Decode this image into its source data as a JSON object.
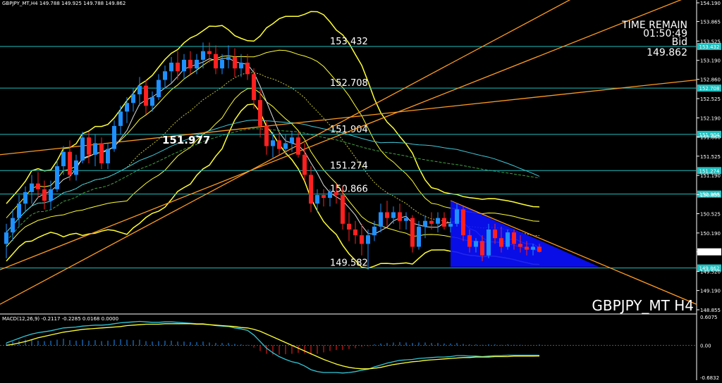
{
  "header": {
    "symbol_line": "GBPJPY_MT,H4  149.788 149.925 149.788 149.862"
  },
  "info_box": {
    "time_remain_label": "TIME REMAIN",
    "time_remain_value": "01:50:49",
    "bid_label": "Bid",
    "bid_value": "149.862"
  },
  "symbol_watermark": "GBPJPY_MT H4",
  "annotation": "151.977",
  "macd": {
    "label": "MACD(12,26,9) -0.2117 -0.2285 0.0168 0.0000",
    "axis_labels": [
      "0.6075",
      "0.00",
      "-0.6832"
    ]
  },
  "colors": {
    "background": "#000000",
    "bull": "#1e90ff",
    "bear": "#ff2020",
    "bollinger": "#ffff33",
    "horizontal_line": "#20c0c0",
    "trendline": "#ff9a20",
    "triangle": "#0a10ff",
    "ma_long": "#40c8d8",
    "macd_signal": "#ffff33",
    "macd_main": "#30c8d8"
  },
  "chart_data": [
    {
      "type": "candlestick",
      "title": "GBPJPY_MT H4",
      "ylim": [
        148.855,
        154.19
      ],
      "y_ticks": [
        154.19,
        153.865,
        153.525,
        153.19,
        152.86,
        152.525,
        152.19,
        151.86,
        151.525,
        151.19,
        150.855,
        150.525,
        150.19,
        149.862,
        149.52,
        149.19,
        148.855
      ],
      "horizontal_lines": [
        {
          "value": 153.432,
          "label": "153.432",
          "axis_label": "153.432"
        },
        {
          "value": 152.708,
          "label": "152.708",
          "axis_label": "152.708"
        },
        {
          "value": 151.904,
          "label": "151.904",
          "axis_label": "151.904"
        },
        {
          "value": 151.274,
          "label": "151.274",
          "axis_label": "151.274"
        },
        {
          "value": 150.866,
          "label": "150.866",
          "axis_label": "150.866"
        },
        {
          "value": 149.582,
          "label": "149.582",
          "axis_label": "149.862"
        }
      ],
      "current_price": 149.862,
      "candles": [
        {
          "o": 150.0,
          "h": 150.35,
          "l": 149.75,
          "c": 150.2
        },
        {
          "o": 150.2,
          "h": 150.6,
          "l": 150.05,
          "c": 150.45
        },
        {
          "o": 150.45,
          "h": 150.85,
          "l": 150.3,
          "c": 150.7
        },
        {
          "o": 150.7,
          "h": 151.0,
          "l": 150.55,
          "c": 150.9
        },
        {
          "o": 150.9,
          "h": 151.2,
          "l": 150.7,
          "c": 151.05
        },
        {
          "o": 151.05,
          "h": 151.25,
          "l": 150.8,
          "c": 150.95
        },
        {
          "o": 150.95,
          "h": 151.1,
          "l": 150.6,
          "c": 150.75
        },
        {
          "o": 150.75,
          "h": 151.1,
          "l": 150.6,
          "c": 150.95
        },
        {
          "o": 150.95,
          "h": 151.45,
          "l": 150.9,
          "c": 151.35
        },
        {
          "o": 151.35,
          "h": 151.7,
          "l": 151.2,
          "c": 151.6
        },
        {
          "o": 151.6,
          "h": 151.8,
          "l": 151.1,
          "c": 151.2
        },
        {
          "o": 151.2,
          "h": 151.55,
          "l": 151.1,
          "c": 151.45
        },
        {
          "o": 151.45,
          "h": 151.95,
          "l": 151.4,
          "c": 151.85
        },
        {
          "o": 151.85,
          "h": 151.95,
          "l": 151.4,
          "c": 151.55
        },
        {
          "o": 151.55,
          "h": 151.9,
          "l": 151.35,
          "c": 151.75
        },
        {
          "o": 151.75,
          "h": 151.85,
          "l": 151.3,
          "c": 151.4
        },
        {
          "o": 151.4,
          "h": 151.75,
          "l": 151.3,
          "c": 151.65
        },
        {
          "o": 151.65,
          "h": 152.15,
          "l": 151.6,
          "c": 152.05
        },
        {
          "o": 152.05,
          "h": 152.4,
          "l": 151.9,
          "c": 152.3
        },
        {
          "o": 152.3,
          "h": 152.55,
          "l": 152.1,
          "c": 152.45
        },
        {
          "o": 152.45,
          "h": 152.7,
          "l": 152.3,
          "c": 152.6
        },
        {
          "o": 152.6,
          "h": 152.9,
          "l": 152.4,
          "c": 152.75
        },
        {
          "o": 152.75,
          "h": 152.85,
          "l": 152.25,
          "c": 152.4
        },
        {
          "o": 152.4,
          "h": 152.65,
          "l": 152.3,
          "c": 152.55
        },
        {
          "o": 152.55,
          "h": 152.95,
          "l": 152.5,
          "c": 152.85
        },
        {
          "o": 152.85,
          "h": 153.1,
          "l": 152.7,
          "c": 153.0
        },
        {
          "o": 153.0,
          "h": 153.25,
          "l": 152.8,
          "c": 153.15
        },
        {
          "o": 153.15,
          "h": 153.35,
          "l": 152.85,
          "c": 153.0
        },
        {
          "o": 153.0,
          "h": 153.3,
          "l": 152.85,
          "c": 153.2
        },
        {
          "o": 153.2,
          "h": 153.35,
          "l": 152.95,
          "c": 153.05
        },
        {
          "o": 153.05,
          "h": 153.3,
          "l": 152.95,
          "c": 153.2
        },
        {
          "o": 153.2,
          "h": 153.5,
          "l": 153.05,
          "c": 153.35
        },
        {
          "o": 153.35,
          "h": 153.5,
          "l": 153.15,
          "c": 153.3
        },
        {
          "o": 153.3,
          "h": 153.45,
          "l": 152.95,
          "c": 153.05
        },
        {
          "o": 153.05,
          "h": 153.3,
          "l": 152.95,
          "c": 153.2
        },
        {
          "o": 153.2,
          "h": 153.45,
          "l": 153.05,
          "c": 153.25
        },
        {
          "o": 153.25,
          "h": 153.4,
          "l": 152.9,
          "c": 153.05
        },
        {
          "o": 153.05,
          "h": 153.3,
          "l": 152.9,
          "c": 153.15
        },
        {
          "o": 153.15,
          "h": 153.3,
          "l": 152.85,
          "c": 152.95
        },
        {
          "o": 152.95,
          "h": 153.05,
          "l": 152.35,
          "c": 152.5
        },
        {
          "o": 152.5,
          "h": 152.7,
          "l": 151.85,
          "c": 152.05
        },
        {
          "o": 152.05,
          "h": 152.15,
          "l": 151.55,
          "c": 151.7
        },
        {
          "o": 151.7,
          "h": 151.95,
          "l": 151.5,
          "c": 151.8
        },
        {
          "o": 151.8,
          "h": 151.95,
          "l": 151.55,
          "c": 151.65
        },
        {
          "o": 151.65,
          "h": 151.9,
          "l": 151.55,
          "c": 151.75
        },
        {
          "o": 151.75,
          "h": 151.95,
          "l": 151.6,
          "c": 151.85
        },
        {
          "o": 151.85,
          "h": 151.95,
          "l": 151.5,
          "c": 151.55
        },
        {
          "o": 151.55,
          "h": 151.75,
          "l": 151.1,
          "c": 151.2
        },
        {
          "o": 151.2,
          "h": 151.35,
          "l": 150.55,
          "c": 150.7
        },
        {
          "o": 150.7,
          "h": 150.95,
          "l": 150.55,
          "c": 150.85
        },
        {
          "o": 150.85,
          "h": 150.95,
          "l": 150.65,
          "c": 150.8
        },
        {
          "o": 150.8,
          "h": 150.95,
          "l": 150.65,
          "c": 150.9
        },
        {
          "o": 150.9,
          "h": 151.05,
          "l": 150.7,
          "c": 150.85
        },
        {
          "o": 150.85,
          "h": 151.0,
          "l": 150.25,
          "c": 150.35
        },
        {
          "o": 150.35,
          "h": 150.55,
          "l": 150.05,
          "c": 150.25
        },
        {
          "o": 150.25,
          "h": 150.4,
          "l": 150.0,
          "c": 150.15
        },
        {
          "o": 150.15,
          "h": 150.35,
          "l": 149.8,
          "c": 150.0
        },
        {
          "o": 150.0,
          "h": 150.25,
          "l": 149.55,
          "c": 150.15
        },
        {
          "o": 150.15,
          "h": 150.4,
          "l": 150.05,
          "c": 150.3
        },
        {
          "o": 150.3,
          "h": 150.7,
          "l": 150.2,
          "c": 150.55
        },
        {
          "o": 150.55,
          "h": 150.75,
          "l": 150.3,
          "c": 150.45
        },
        {
          "o": 150.45,
          "h": 150.65,
          "l": 150.35,
          "c": 150.55
        },
        {
          "o": 150.55,
          "h": 150.7,
          "l": 150.25,
          "c": 150.4
        },
        {
          "o": 150.4,
          "h": 150.55,
          "l": 150.25,
          "c": 150.45
        },
        {
          "o": 150.45,
          "h": 150.5,
          "l": 149.85,
          "c": 149.95
        },
        {
          "o": 149.95,
          "h": 150.4,
          "l": 149.9,
          "c": 150.3
        },
        {
          "o": 150.3,
          "h": 150.5,
          "l": 150.1,
          "c": 150.4
        },
        {
          "o": 150.4,
          "h": 150.55,
          "l": 150.25,
          "c": 150.35
        },
        {
          "o": 150.35,
          "h": 150.55,
          "l": 150.2,
          "c": 150.45
        },
        {
          "o": 150.45,
          "h": 150.55,
          "l": 150.25,
          "c": 150.3
        },
        {
          "o": 150.3,
          "h": 150.45,
          "l": 150.2,
          "c": 150.35
        },
        {
          "o": 150.35,
          "h": 150.7,
          "l": 150.3,
          "c": 150.6
        },
        {
          "o": 150.6,
          "h": 150.65,
          "l": 150.05,
          "c": 150.15
        },
        {
          "o": 150.15,
          "h": 150.25,
          "l": 149.85,
          "c": 149.95
        },
        {
          "o": 149.95,
          "h": 150.1,
          "l": 149.85,
          "c": 150.05
        },
        {
          "o": 150.05,
          "h": 150.15,
          "l": 149.7,
          "c": 149.8
        },
        {
          "o": 149.8,
          "h": 150.35,
          "l": 149.75,
          "c": 150.25
        },
        {
          "o": 150.25,
          "h": 150.35,
          "l": 150.0,
          "c": 150.1
        },
        {
          "o": 150.1,
          "h": 150.3,
          "l": 149.85,
          "c": 149.95
        },
        {
          "o": 149.95,
          "h": 150.25,
          "l": 149.9,
          "c": 150.2
        },
        {
          "o": 150.2,
          "h": 150.25,
          "l": 149.9,
          "c": 150.0
        },
        {
          "o": 150.0,
          "h": 150.15,
          "l": 149.85,
          "c": 149.95
        },
        {
          "o": 149.95,
          "h": 150.05,
          "l": 149.8,
          "c": 149.9
        },
        {
          "o": 149.9,
          "h": 150.0,
          "l": 149.8,
          "c": 149.95
        },
        {
          "o": 149.95,
          "h": 150.0,
          "l": 149.85,
          "c": 149.862
        }
      ]
    },
    {
      "type": "bar",
      "title": "MACD(12,26,9)",
      "ylim": [
        -0.6832,
        0.6075
      ],
      "histogram": [
        0.05,
        0.08,
        0.1,
        0.12,
        0.12,
        0.1,
        0.09,
        0.1,
        0.12,
        0.14,
        0.11,
        0.1,
        0.12,
        0.1,
        0.11,
        0.09,
        0.1,
        0.12,
        0.13,
        0.12,
        0.11,
        0.12,
        0.09,
        0.08,
        0.09,
        0.1,
        0.1,
        0.08,
        0.08,
        0.07,
        0.07,
        0.08,
        0.06,
        0.05,
        0.05,
        0.05,
        0.03,
        0.02,
        0.01,
        -0.05,
        -0.12,
        -0.18,
        -0.2,
        -0.2,
        -0.19,
        -0.18,
        -0.16,
        -0.17,
        -0.2,
        -0.18,
        -0.15,
        -0.12,
        -0.1,
        -0.1,
        -0.08,
        -0.06,
        -0.03,
        -0.02,
        0.02,
        0.04,
        0.05,
        0.06,
        0.07,
        0.06,
        0.05,
        0.06,
        0.06,
        0.05,
        0.05,
        0.04,
        0.04,
        0.05,
        0.03,
        0.02,
        0.02,
        0.01,
        0.02,
        0.02,
        0.01,
        0.02,
        0.01,
        0.01,
        0.0,
        0.0,
        0.0168
      ],
      "main": [
        0.05,
        0.1,
        0.15,
        0.2,
        0.24,
        0.27,
        0.29,
        0.31,
        0.34,
        0.37,
        0.38,
        0.39,
        0.41,
        0.42,
        0.43,
        0.43,
        0.44,
        0.46,
        0.48,
        0.49,
        0.5,
        0.51,
        0.5,
        0.49,
        0.49,
        0.5,
        0.5,
        0.49,
        0.48,
        0.47,
        0.46,
        0.46,
        0.44,
        0.42,
        0.41,
        0.4,
        0.37,
        0.35,
        0.32,
        0.22,
        0.08,
        -0.06,
        -0.16,
        -0.24,
        -0.3,
        -0.35,
        -0.38,
        -0.44,
        -0.52,
        -0.56,
        -0.58,
        -0.58,
        -0.58,
        -0.59,
        -0.58,
        -0.56,
        -0.53,
        -0.51,
        -0.46,
        -0.42,
        -0.38,
        -0.35,
        -0.32,
        -0.31,
        -0.3,
        -0.28,
        -0.27,
        -0.26,
        -0.25,
        -0.25,
        -0.24,
        -0.22,
        -0.22,
        -0.23,
        -0.23,
        -0.24,
        -0.23,
        -0.22,
        -0.22,
        -0.21,
        -0.21,
        -0.21,
        -0.21,
        -0.21,
        -0.2117
      ],
      "signal": [
        0.0,
        0.02,
        0.05,
        0.08,
        0.12,
        0.16,
        0.19,
        0.22,
        0.25,
        0.28,
        0.3,
        0.32,
        0.34,
        0.35,
        0.36,
        0.37,
        0.38,
        0.39,
        0.4,
        0.42,
        0.43,
        0.44,
        0.45,
        0.45,
        0.45,
        0.46,
        0.46,
        0.46,
        0.46,
        0.46,
        0.45,
        0.45,
        0.44,
        0.43,
        0.42,
        0.41,
        0.4,
        0.38,
        0.37,
        0.34,
        0.3,
        0.24,
        0.18,
        0.12,
        0.06,
        0.0,
        -0.06,
        -0.12,
        -0.18,
        -0.24,
        -0.3,
        -0.35,
        -0.4,
        -0.44,
        -0.47,
        -0.49,
        -0.5,
        -0.5,
        -0.49,
        -0.47,
        -0.44,
        -0.41,
        -0.39,
        -0.37,
        -0.35,
        -0.34,
        -0.32,
        -0.31,
        -0.3,
        -0.29,
        -0.28,
        -0.27,
        -0.26,
        -0.26,
        -0.25,
        -0.25,
        -0.25,
        -0.24,
        -0.24,
        -0.24,
        -0.23,
        -0.23,
        -0.23,
        -0.23,
        -0.2285
      ]
    }
  ]
}
